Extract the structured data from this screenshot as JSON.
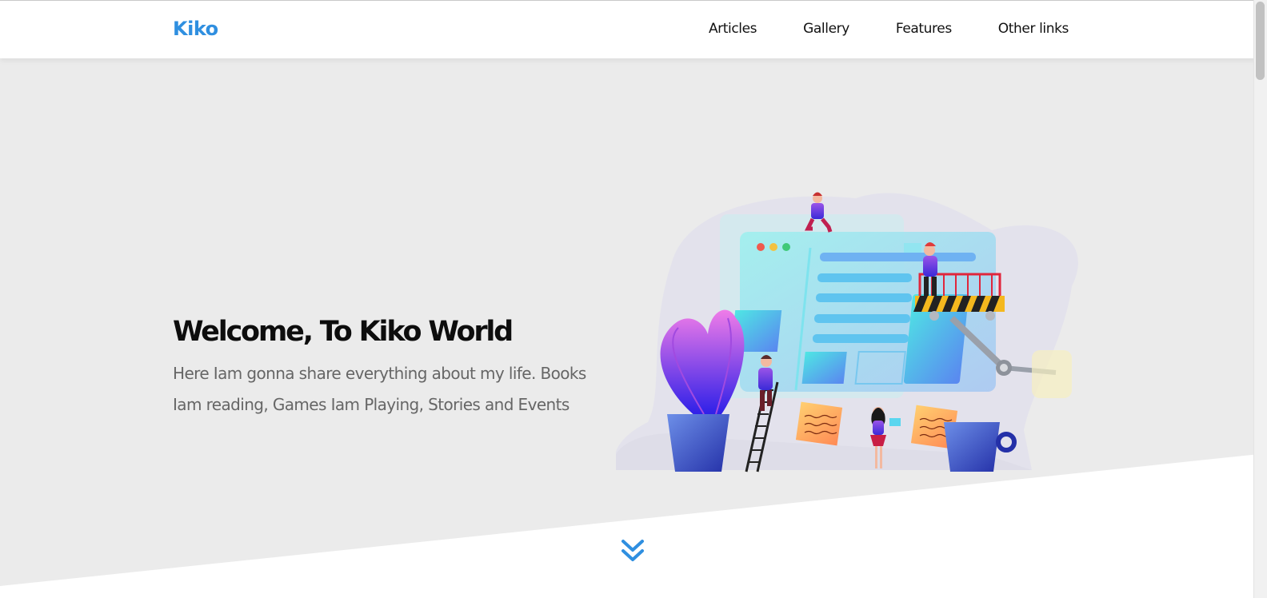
{
  "header": {
    "logo": "Kiko",
    "nav": [
      "Articles",
      "Gallery",
      "Features",
      "Other links"
    ]
  },
  "hero": {
    "title": "Welcome, To Kiko World",
    "description": "Here Iam gonna share everything about my life. Books Iam reading, Games Iam Playing, Stories and Events"
  },
  "colors": {
    "brand": "#2f8fe0",
    "hero_background": "#ebebeb",
    "heading": "#0d0d0d",
    "body_text": "#666666"
  },
  "icons": {
    "scroll_down": "double-chevron-down-icon",
    "illustration": "website-construction-illustration"
  }
}
